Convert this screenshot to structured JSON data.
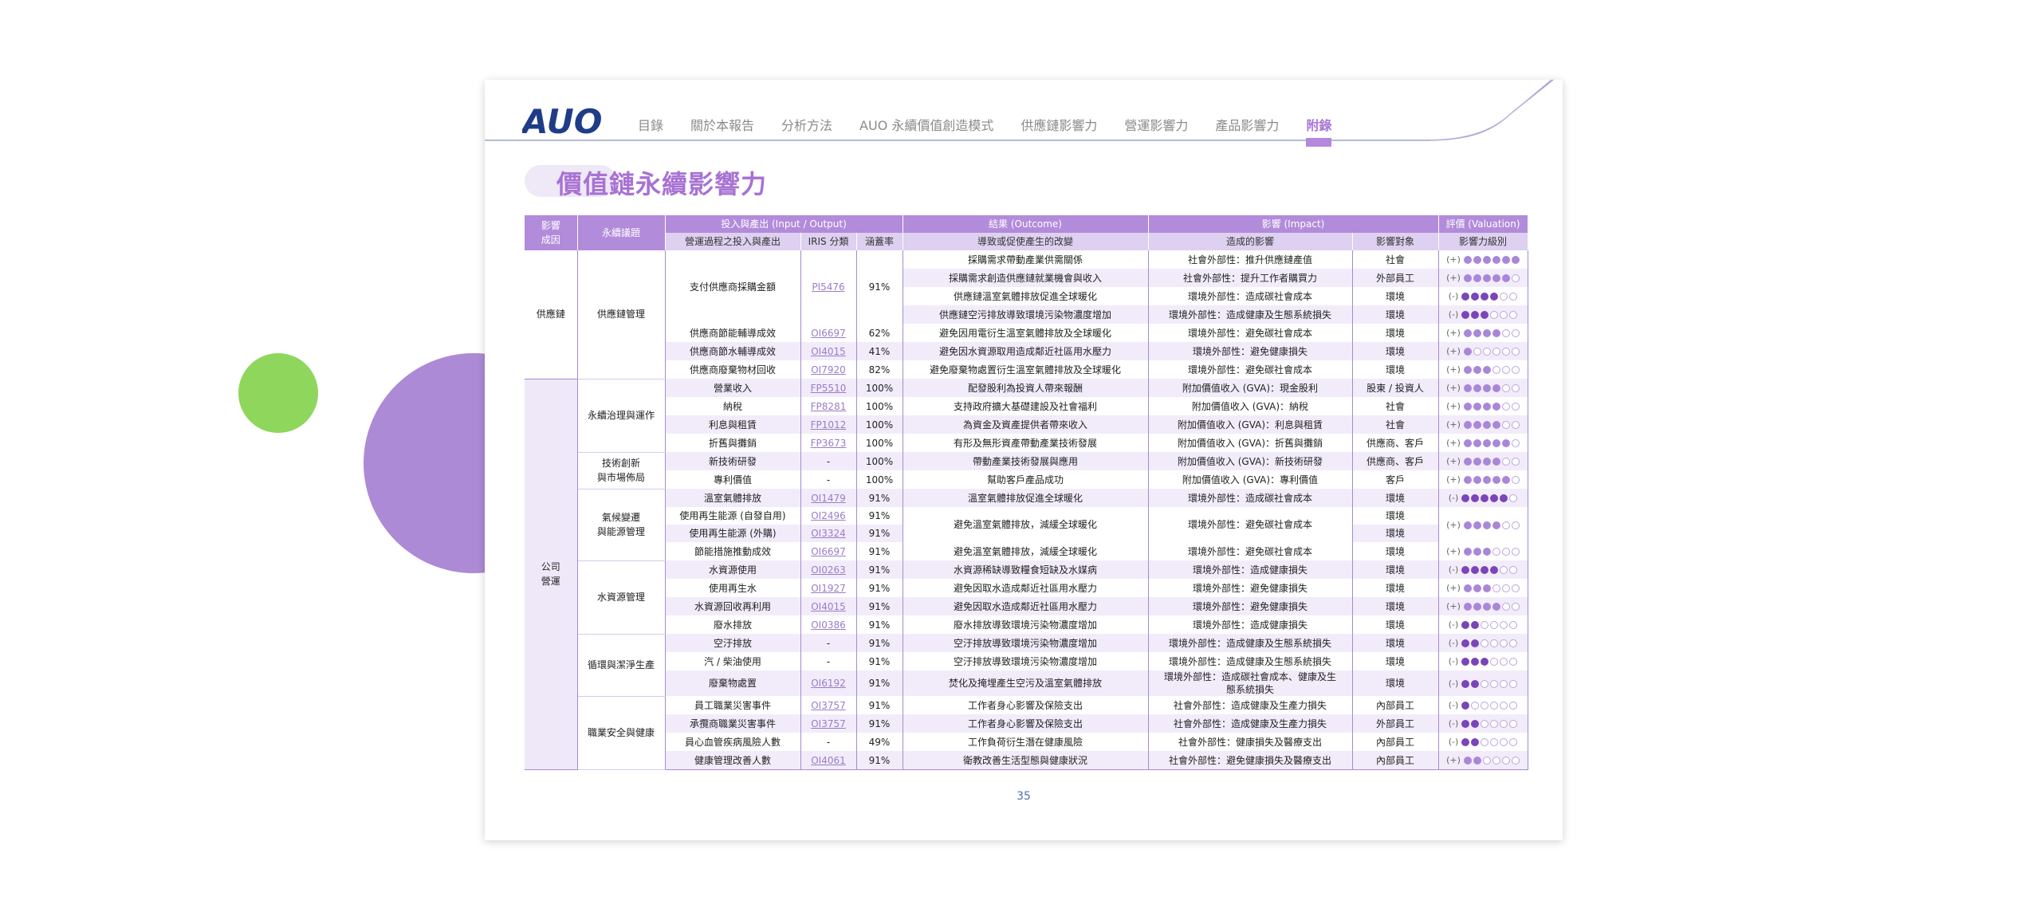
{
  "brand": {
    "logo": "AUO",
    "color": "#1f3c88",
    "accent": "#a876d6"
  },
  "nav": [
    {
      "label": "目錄"
    },
    {
      "label": "關於本報告"
    },
    {
      "label": "分析方法"
    },
    {
      "label": "AUO 永續價值創造模式"
    },
    {
      "label": "供應鏈影響力"
    },
    {
      "label": "營運影響力"
    },
    {
      "label": "產品影響力"
    },
    {
      "label": "附錄",
      "active": true
    }
  ],
  "title": "價值鏈永續影響力",
  "headers": {
    "group": [
      "影響\n成因",
      "永續議題",
      "投入與產出 (Input / Output)",
      "結果 (Outcome)",
      "影響 (Impact)",
      "評價 (Valuation)"
    ],
    "sub": [
      "營運過程之投入與產出",
      "IRIS 分類",
      "涵蓋率",
      "導致或促使產生的改變",
      "造成的影響",
      "影響對象",
      "影響力級別"
    ],
    "cause_lines": [
      "影響",
      "成因"
    ]
  },
  "causes": {
    "supply": "供應鏈",
    "company": [
      "公司",
      "營運"
    ]
  },
  "topics": {
    "supply_mgmt": "供應鏈管理",
    "governance": "永續治理與運作",
    "innovation": [
      "技術創新",
      "與市場佈局"
    ],
    "climate": [
      "氣候變遷",
      "與能源管理"
    ],
    "water": "水資源管理",
    "pollution": "循環與潔淨生產",
    "safety": "職業安全與健康"
  },
  "rows": [
    {
      "io": "支付供應商採購金額",
      "code": "PI5476",
      "cov": "91%",
      "outcome": "採購需求帶動產業供需關係",
      "impact": "社會外部性：推升供應鏈產值",
      "target": "社會",
      "sign": "(+)",
      "on": 6,
      "dark": 0
    },
    {
      "io": "",
      "code": "",
      "cov": "",
      "outcome": "採購需求創造供應鏈就業機會與收入",
      "impact": "社會外部性：提升工作者購買力",
      "target": "外部員工",
      "sign": "(+)",
      "on": 5,
      "dark": 0
    },
    {
      "io": "",
      "code": "",
      "cov": "",
      "outcome": "供應鏈溫室氣體排放促進全球暖化",
      "impact": "環境外部性：造成碳社會成本",
      "target": "環境",
      "sign": "(-)",
      "on": 0,
      "dark": 4
    },
    {
      "io": "",
      "code": "",
      "cov": "",
      "outcome": "供應鏈空污排放導致環境污染物濃度增加",
      "impact": "環境外部性：造成健康及生態系統損失",
      "target": "環境",
      "sign": "(-)",
      "on": 0,
      "dark": 3
    },
    {
      "io": "供應商節能輔導成效",
      "code": "OI6697",
      "cov": "62%",
      "outcome": "避免因用電衍生溫室氣體排放及全球暖化",
      "impact": "環境外部性：避免碳社會成本",
      "target": "環境",
      "sign": "(+)",
      "on": 4,
      "dark": 0
    },
    {
      "io": "供應商節水輔導成效",
      "code": "OI4015",
      "cov": "41%",
      "outcome": "避免因水資源取用造成鄰近社區用水壓力",
      "impact": "環境外部性：避免健康損失",
      "target": "環境",
      "sign": "(+)",
      "on": 1,
      "dark": 0
    },
    {
      "io": "供應商廢棄物材回收",
      "code": "OI7920",
      "cov": "82%",
      "outcome": "避免廢棄物處置衍生溫室氣體排放及全球暖化",
      "impact": "環境外部性：避免碳社會成本",
      "target": "環境",
      "sign": "(+)",
      "on": 3,
      "dark": 0
    },
    {
      "io": "營業收入",
      "code": "FP5510",
      "cov": "100%",
      "outcome": "配發股利為投資人帶來報酬",
      "impact": "附加價值收入 (GVA)：現金股利",
      "target": "股東 / 投資人",
      "sign": "(+)",
      "on": 4,
      "dark": 0
    },
    {
      "io": "納稅",
      "code": "FP8281",
      "cov": "100%",
      "outcome": "支持政府擴大基礎建設及社會福利",
      "impact": "附加價值收入 (GVA)：納稅",
      "target": "社會",
      "sign": "(+)",
      "on": 4,
      "dark": 0
    },
    {
      "io": "利息與租賃",
      "code": "FP1012",
      "cov": "100%",
      "outcome": "為資金及資產提供者帶來收入",
      "impact": "附加價值收入 (GVA)：利息與租賃",
      "target": "社會",
      "sign": "(+)",
      "on": 4,
      "dark": 0
    },
    {
      "io": "折舊與攤銷",
      "code": "FP3673",
      "cov": "100%",
      "outcome": "有形及無形資產帶動產業技術發展",
      "impact": "附加價值收入 (GVA)：折舊與攤銷",
      "target": "供應商、客戶",
      "sign": "(+)",
      "on": 5,
      "dark": 0
    },
    {
      "io": "新技術研發",
      "code": "-",
      "cov": "100%",
      "outcome": "帶動產業技術發展與應用",
      "impact": "附加價值收入 (GVA)：新技術研發",
      "target": "供應商、客戶",
      "sign": "(+)",
      "on": 4,
      "dark": 0
    },
    {
      "io": "專利價值",
      "code": "-",
      "cov": "100%",
      "outcome": "幫助客戶產品成功",
      "impact": "附加價值收入 (GVA)：專利價值",
      "target": "客戶",
      "sign": "(+)",
      "on": 5,
      "dark": 0
    },
    {
      "io": "溫室氣體排放",
      "code": "OI1479",
      "cov": "91%",
      "outcome": "溫室氣體排放促進全球暖化",
      "impact": "環境外部性：造成碳社會成本",
      "target": "環境",
      "sign": "(-)",
      "on": 0,
      "dark": 5
    },
    {
      "io": "使用再生能源 (自發自用)",
      "code": "OI2496",
      "cov": "91%",
      "outcome": "避免溫室氣體排放，減緩全球暖化",
      "impact": "環境外部性：避免碳社會成本",
      "target": "環境",
      "sign": "(+)",
      "on": 4,
      "dark": 0
    },
    {
      "io": "使用再生能源 (外購)",
      "code": "OI3324",
      "cov": "91%",
      "outcome": "",
      "impact": "",
      "target": "環境",
      "sign": "",
      "on": 0,
      "dark": 0
    },
    {
      "io": "節能措施推動成效",
      "code": "OI6697",
      "cov": "91%",
      "outcome": "避免溫室氣體排放，減緩全球暖化",
      "impact": "環境外部性：避免碳社會成本",
      "target": "環境",
      "sign": "(+)",
      "on": 3,
      "dark": 0
    },
    {
      "io": "水資源使用",
      "code": "OI0263",
      "cov": "91%",
      "outcome": "水資源稀缺導致糧食短缺及水媒病",
      "impact": "環境外部性：造成健康損失",
      "target": "環境",
      "sign": "(-)",
      "on": 0,
      "dark": 4
    },
    {
      "io": "使用再生水",
      "code": "OI1927",
      "cov": "91%",
      "outcome": "避免因取水造成鄰近社區用水壓力",
      "impact": "環境外部性：避免健康損失",
      "target": "環境",
      "sign": "(+)",
      "on": 3,
      "dark": 0
    },
    {
      "io": "水資源回收再利用",
      "code": "OI4015",
      "cov": "91%",
      "outcome": "避免因取水造成鄰近社區用水壓力",
      "impact": "環境外部性：避免健康損失",
      "target": "環境",
      "sign": "(+)",
      "on": 4,
      "dark": 0
    },
    {
      "io": "廢水排放",
      "code": "OI0386",
      "cov": "91%",
      "outcome": "廢水排放導致環境污染物濃度增加",
      "impact": "環境外部性：造成健康損失",
      "target": "環境",
      "sign": "(-)",
      "on": 0,
      "dark": 2
    },
    {
      "io": "空汙排放",
      "code": "-",
      "cov": "91%",
      "outcome": "空汙排放導致環境污染物濃度增加",
      "impact": "環境外部性：造成健康及生態系統損失",
      "target": "環境",
      "sign": "(-)",
      "on": 0,
      "dark": 2
    },
    {
      "io": "汽 / 柴油使用",
      "code": "-",
      "cov": "91%",
      "outcome": "空汙排放導致環境污染物濃度增加",
      "impact": "環境外部性：造成健康及生態系統損失",
      "target": "環境",
      "sign": "(-)",
      "on": 0,
      "dark": 3
    },
    {
      "io": "廢棄物處置",
      "code": "OI6192",
      "cov": "91%",
      "outcome": "焚化及掩埋產生空污及溫室氣體排放",
      "impact": "環境外部性：造成碳社會成本、健康及生態系統損失",
      "impact_lines": [
        "環境外部性：造成碳社會成本、健康及生",
        "態系統損失"
      ],
      "target": "環境",
      "sign": "(-)",
      "on": 0,
      "dark": 2
    },
    {
      "io": "員工職業災害事件",
      "code": "OI3757",
      "cov": "91%",
      "outcome": "工作者身心影響及保險支出",
      "impact": "社會外部性：造成健康及生產力損失",
      "target": "內部員工",
      "sign": "(-)",
      "on": 0,
      "dark": 1
    },
    {
      "io": "承攬商職業災害事件",
      "code": "OI3757",
      "cov": "91%",
      "outcome": "工作者身心影響及保險支出",
      "impact": "社會外部性：造成健康及生產力損失",
      "target": "外部員工",
      "sign": "(-)",
      "on": 0,
      "dark": 2
    },
    {
      "io": "員心血管疾病風險人數",
      "code": "-",
      "cov": "49%",
      "outcome": "工作負荷衍生潛在健康風險",
      "impact": "社會外部性：健康損失及醫療支出",
      "target": "內部員工",
      "sign": "(-)",
      "on": 0,
      "dark": 2
    },
    {
      "io": "健康管理改善人數",
      "code": "OI4061",
      "cov": "91%",
      "outcome": "衛教改善生活型態與健康狀況",
      "impact": "社會外部性：避免健康損失及醫療支出",
      "target": "內部員工",
      "sign": "(+)",
      "on": 2,
      "dark": 0
    }
  ],
  "page_number": "35"
}
